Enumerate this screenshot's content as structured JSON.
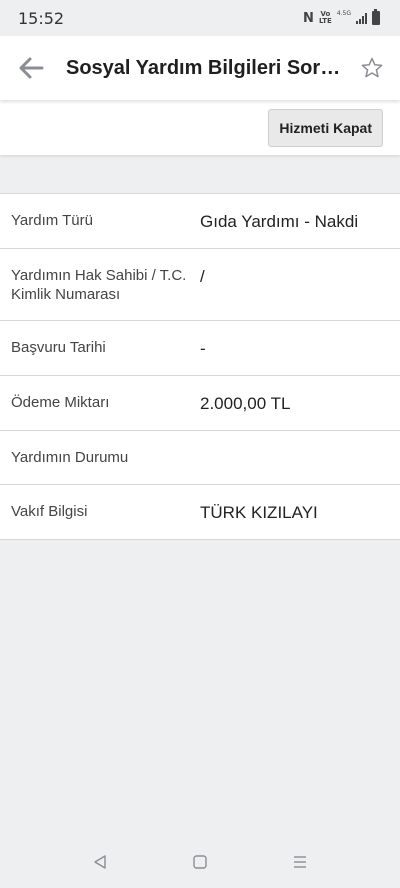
{
  "status_bar": {
    "time": "15:52",
    "icons": [
      "nfc-icon",
      "volte-icon",
      "4g-icon",
      "signal-icon",
      "battery-icon"
    ],
    "nfc_glyph": "N",
    "volte_top": "Vo",
    "volte_bottom": "LTE",
    "net": "4.5G"
  },
  "app_bar": {
    "title": "Sosyal Yardım Bilgileri Sorgulama",
    "back_icon": "arrow-left-icon",
    "favorite_icon": "star-outline-icon"
  },
  "actions": {
    "close_service_label": "Hizmeti Kapat"
  },
  "details": {
    "rows": [
      {
        "label": "Yardım Türü",
        "value": "Gıda Yardımı - Nakdi"
      },
      {
        "label": "Yardımın Hak Sahibi / T.C. Kimlik Numarası",
        "value": "/"
      },
      {
        "label": "Başvuru Tarihi",
        "value": "-"
      },
      {
        "label": "Ödeme Miktarı",
        "value": "2.000,00 TL"
      },
      {
        "label": "Yardımın Durumu",
        "value": ""
      },
      {
        "label": "Vakıf Bilgisi",
        "value": "TÜRK KIZILAYI"
      }
    ]
  },
  "nav_bar": {
    "buttons": [
      "back-triangle-icon",
      "home-square-icon",
      "menu-lines-icon"
    ]
  },
  "colors": {
    "background": "#eeeff1",
    "surface": "#ffffff",
    "divider": "#d8d8d8",
    "icon": "#8a8d93"
  }
}
